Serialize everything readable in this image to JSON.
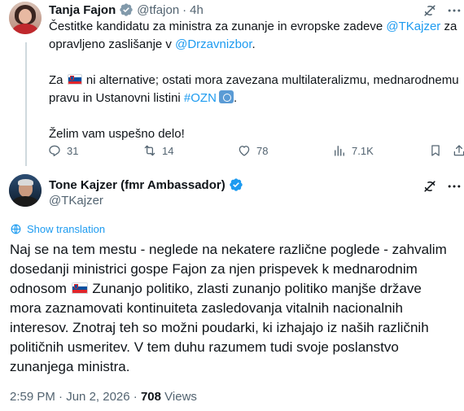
{
  "parent_tweet": {
    "author_name": "Tanja Fajon",
    "handle": "@tfajon",
    "separator": "·",
    "time": "4h",
    "line1_text": "Čestitke kandidatu za ministra za zunanje in evropske zadeve ",
    "line1_mention": "@TKajzer",
    "line1_end": " za",
    "line2_text": "opravljeno zaslišanje v ",
    "line2_mention": "@Drzavnizbor",
    "line2_end": ".",
    "line3_start": "Za ",
    "line3_text": " ni alternative; ostati mora zavezana multilateralizmu, mednarodnemu",
    "line4_text": "pravu in Ustanovni listini ",
    "line4_hashtag": "#OZN",
    "line4_end": ".",
    "line5_text": "Želim vam uspešno delo!",
    "flag_icon": "slovenia-flag-emoji",
    "un_icon": "united-nations-emoji",
    "stats": {
      "replies": "31",
      "reposts": "14",
      "likes": "78",
      "views": "7.1K"
    }
  },
  "main_tweet": {
    "author_name": "Tone Kajzer (fmr Ambassador)",
    "handle": "@TKajzer",
    "translate_label": "Show translation",
    "line1": "Naj se na tem mestu - neglede na nekatere različne poglede -  zahvalim",
    "line2": "dosedanji ministrici gospe Fajon za njen prispevek k mednarodnim",
    "line3_start": "odnosom ",
    "line3_end": " Zunanjo politiko, zlasti zunanjo politiko manjše države",
    "line4": "mora zaznamovati kontinuiteta zasledovanja vitalnih nacionalnih",
    "line5": "interesov. Znotraj teh so možni poudarki, ki izhajajo iz naših različnih",
    "line6": "političnih usmeritev. V tem duhu razumem tudi svoje poslanstvo",
    "line7": "zunanjega ministra.",
    "time": "2:59 PM",
    "separator": "·",
    "date": "Jun 2, 2026",
    "separator2": "·",
    "views_count": "708",
    "views_label": "Views"
  },
  "colors": {
    "accent": "#1d9bf0",
    "text": "#0f1419",
    "muted": "#536471",
    "thread_line": "#cfd9de"
  }
}
